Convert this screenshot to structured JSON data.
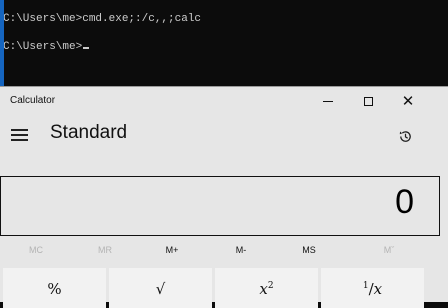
{
  "console": {
    "line1": "C:\\Users\\me>cmd.exe;:/c,,;calc",
    "line2": "C:\\Users\\me>"
  },
  "calculator": {
    "window_title": "Calculator",
    "mode_title": "Standard",
    "display_value": "0",
    "memory": [
      "MC",
      "MR",
      "M+",
      "M-",
      "MS",
      "Mˇ"
    ],
    "keys": {
      "percent": "%",
      "sqrt": "√",
      "square_base": "x",
      "square_exp": "2",
      "recip_num": "1",
      "recip_den": "x"
    }
  },
  "colors": {
    "console_bg": "#0c0c0c",
    "calc_bg": "#e6e6e6",
    "key_bg": "#f2f2f2",
    "desktop_edge": "#1565c0"
  }
}
